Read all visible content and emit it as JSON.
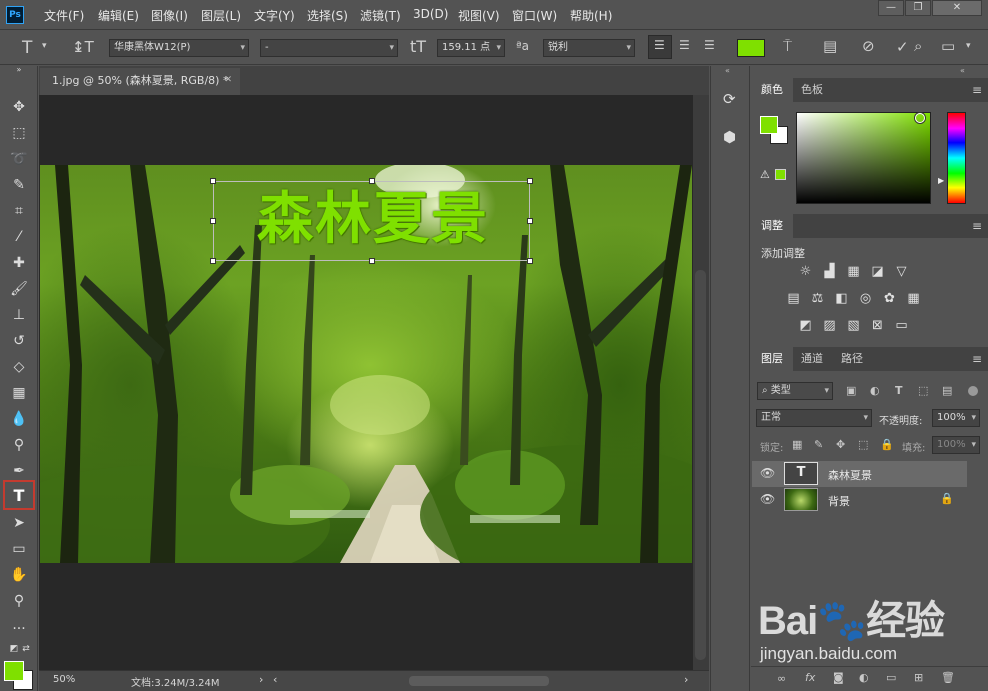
{
  "app": {
    "logo": "Ps"
  },
  "menu": [
    "文件(F)",
    "编辑(E)",
    "图像(I)",
    "图层(L)",
    "文字(Y)",
    "选择(S)",
    "滤镜(T)",
    "3D(D)",
    "视图(V)",
    "窗口(W)",
    "帮助(H)"
  ],
  "window_controls": {
    "minimize": "—",
    "restore": "❐",
    "close": "✕"
  },
  "options": {
    "font_family": "华康黑体W12(P)",
    "font_style": "-",
    "font_size": "159.11 点",
    "antialias": "锐利",
    "text_color": "#7fe000"
  },
  "document": {
    "tab_title": "1.jpg @ 50% (森林夏景, RGB/8) *",
    "tab_close": "✕",
    "text_layer_content": "森林夏景",
    "zoom": "50%",
    "doc_size": "文档:3.24M/3.24M"
  },
  "panels": {
    "color_tabs": [
      "颜色",
      "色板"
    ],
    "adjust_tab": "调整",
    "adjust_title": "添加调整",
    "layers_tabs": [
      "图层",
      "通道",
      "路径"
    ],
    "filter_kind": "类型",
    "blend_mode": "正常",
    "opacity_label": "不透明度:",
    "opacity_value": "100%",
    "lock_label": "锁定:",
    "fill_label": "填充:",
    "fill_value": "100%",
    "layers": [
      {
        "name": "森林夏景",
        "kind": "text",
        "selected": true
      },
      {
        "name": "背景",
        "kind": "image",
        "locked": true
      }
    ]
  },
  "colors": {
    "foreground": "#7fe000",
    "background": "#ffffff",
    "highlight": "#c43b2f"
  },
  "watermark": {
    "text": "jingyan.baidu.com"
  }
}
